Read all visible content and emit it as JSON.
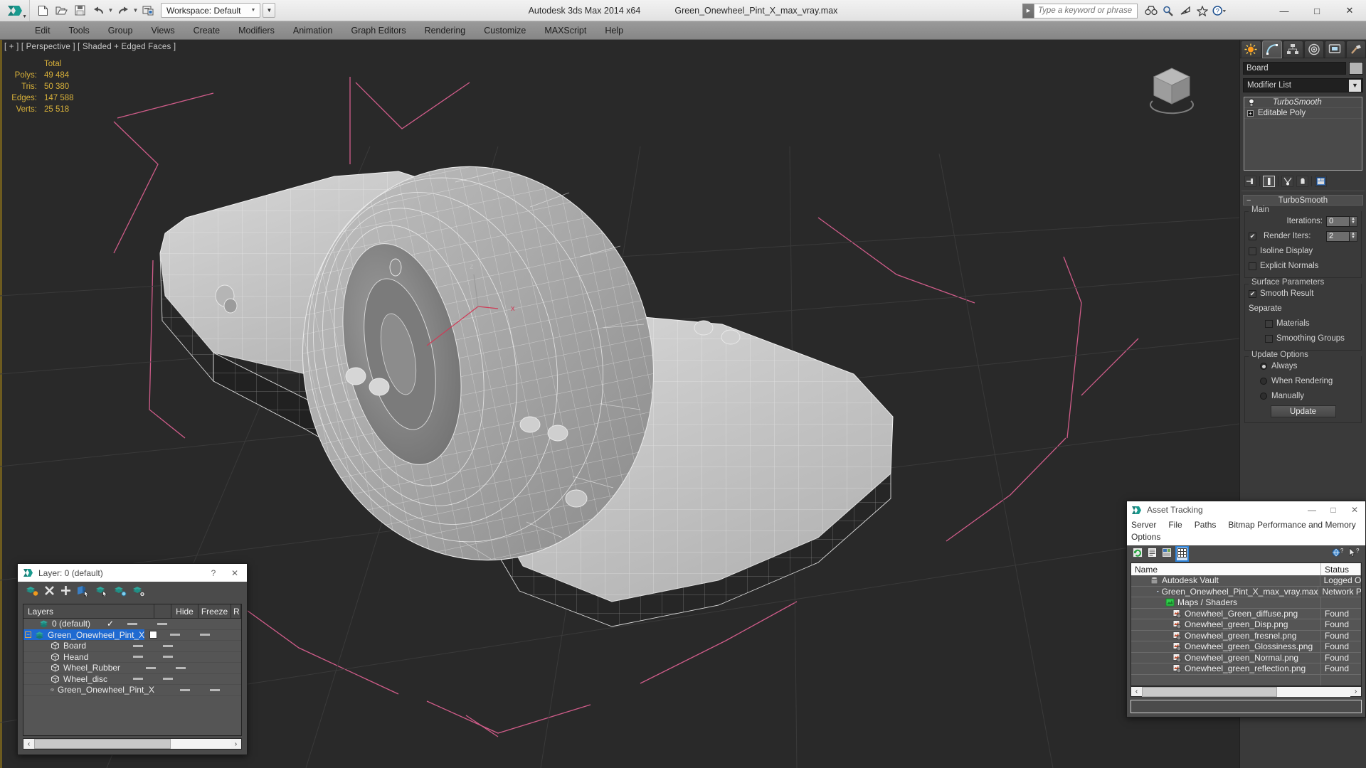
{
  "app": {
    "title": "Autodesk 3ds Max  2014 x64",
    "filename": "Green_Onewheel_Pint_X_max_vray.max",
    "workspace_label": "Workspace: Default",
    "search_placeholder": "Type a keyword or phrase"
  },
  "quick_access": [
    {
      "name": "new-file-icon",
      "tip": "New"
    },
    {
      "name": "open-file-icon",
      "tip": "Open"
    },
    {
      "name": "save-file-icon",
      "tip": "Save"
    },
    {
      "name": "undo-icon",
      "tip": "Undo"
    },
    {
      "name": "redo-icon",
      "tip": "Redo"
    },
    {
      "name": "project-folder-icon",
      "tip": "Set Project Folder"
    }
  ],
  "help_icons": [
    {
      "name": "search-binoculars-icon"
    },
    {
      "name": "magnifier-icon"
    },
    {
      "name": "satellite-icon"
    },
    {
      "name": "favorites-star-icon"
    },
    {
      "name": "help-question-icon"
    }
  ],
  "window_buttons": {
    "minimize": "—",
    "maximize": "□",
    "close": "✕"
  },
  "menu": [
    "Edit",
    "Tools",
    "Group",
    "Views",
    "Create",
    "Modifiers",
    "Animation",
    "Graph Editors",
    "Rendering",
    "Customize",
    "MAXScript",
    "Help"
  ],
  "viewport": {
    "label": "[ + ] [ Perspective ] [ Shaded + Edged Faces ]",
    "stats_header": "Total",
    "stats": [
      {
        "key": "Polys:",
        "value": "49 484"
      },
      {
        "key": "Tris:",
        "value": "50 380"
      },
      {
        "key": "Edges:",
        "value": "147 588"
      },
      {
        "key": "Verts:",
        "value": "25 518"
      }
    ],
    "stat_color": "#d8b13a",
    "background": "#292929"
  },
  "command_panel": {
    "tabs": [
      {
        "name": "create-tab",
        "label": "Create",
        "active": false
      },
      {
        "name": "modify-tab",
        "label": "Modify",
        "active": true
      },
      {
        "name": "hierarchy-tab",
        "label": "Hierarchy",
        "active": false
      },
      {
        "name": "motion-tab",
        "label": "Motion",
        "active": false
      },
      {
        "name": "display-tab",
        "label": "Display",
        "active": false
      },
      {
        "name": "utilities-tab",
        "label": "Utilities",
        "active": false
      }
    ],
    "object_name": "Board",
    "modifier_list_label": "Modifier List",
    "stack": [
      {
        "label": "TurboSmooth",
        "type": "modifier",
        "italic": true
      },
      {
        "label": "Editable Poly",
        "type": "base",
        "italic": false
      }
    ],
    "stack_tools": [
      {
        "name": "pin-stack-icon"
      },
      {
        "name": "show-end-result-icon",
        "active": true
      },
      {
        "name": "make-unique-icon"
      },
      {
        "name": "remove-modifier-icon"
      },
      {
        "name": "configure-modifier-sets-icon"
      }
    ],
    "rollout": {
      "title": "TurboSmooth",
      "groups": [
        {
          "title": "Main",
          "fields": [
            {
              "type": "spinner",
              "label": "Iterations:",
              "value": "0"
            },
            {
              "type": "spinner-check",
              "label": "Render Iters:",
              "value": "2",
              "checked": true
            },
            {
              "type": "checkbox",
              "label": "Isoline Display",
              "checked": false
            },
            {
              "type": "checkbox",
              "label": "Explicit Normals",
              "checked": false
            }
          ]
        },
        {
          "title": "Surface Parameters",
          "fields": [
            {
              "type": "checkbox",
              "label": "Smooth Result",
              "checked": true
            },
            {
              "type": "label",
              "label": "Separate"
            },
            {
              "type": "checkbox",
              "label": "Materials",
              "checked": false,
              "indent": true
            },
            {
              "type": "checkbox",
              "label": "Smoothing Groups",
              "checked": false,
              "indent": true
            }
          ]
        },
        {
          "title": "Update Options",
          "fields": [
            {
              "type": "radio",
              "label": "Always",
              "checked": true
            },
            {
              "type": "radio",
              "label": "When Rendering",
              "checked": false
            },
            {
              "type": "radio",
              "label": "Manually",
              "checked": false
            },
            {
              "type": "button",
              "label": "Update"
            }
          ]
        }
      ]
    }
  },
  "layer_dialog": {
    "title": "Layer: 0 (default)",
    "help_btn": "?",
    "close_btn": "✕",
    "toolbar": [
      {
        "name": "create-new-layer-icon"
      },
      {
        "name": "delete-layer-icon"
      },
      {
        "name": "add-selection-to-layer-icon"
      },
      {
        "name": "select-objects-in-layer-icon"
      },
      {
        "name": "select-highlighted-objects-icon"
      },
      {
        "name": "highlight-selected-objects-icon"
      },
      {
        "name": "layer-properties-icon"
      }
    ],
    "columns": [
      "Layers",
      "",
      "Hide",
      "Freeze",
      "R"
    ],
    "rows": [
      {
        "label": "0 (default)",
        "indent": 1,
        "icon": "layer-icon",
        "current": true,
        "selected": false,
        "expander": ""
      },
      {
        "label": "Green_Onewheel_Pint_X",
        "indent": 0,
        "icon": "layer-icon",
        "current": false,
        "selected": true,
        "expander": "-"
      },
      {
        "label": "Board",
        "indent": 2,
        "icon": "object-icon",
        "current": false,
        "selected": false,
        "expander": ""
      },
      {
        "label": "Heand",
        "indent": 2,
        "icon": "object-icon",
        "current": false,
        "selected": false,
        "expander": ""
      },
      {
        "label": "Wheel_Rubber",
        "indent": 2,
        "icon": "object-icon",
        "current": false,
        "selected": false,
        "expander": ""
      },
      {
        "label": "Wheel_disc",
        "indent": 2,
        "icon": "object-icon",
        "current": false,
        "selected": false,
        "expander": ""
      },
      {
        "label": "Green_Onewheel_Pint_X",
        "indent": 2,
        "icon": "object-icon",
        "current": false,
        "selected": false,
        "expander": ""
      }
    ],
    "scroll_left": "‹",
    "scroll_right": "›"
  },
  "asset_tracking": {
    "title": "Asset Tracking",
    "menu": [
      "Server",
      "File",
      "Paths",
      "Bitmap Performance and Memory",
      "Options"
    ],
    "toolbar": [
      {
        "name": "refresh-icon"
      },
      {
        "name": "list-view-icon"
      },
      {
        "name": "thumbnail-view-icon"
      },
      {
        "name": "grid-view-icon",
        "active": true
      },
      {
        "name": "network-help-icon"
      },
      {
        "name": "help-cursor-icon"
      }
    ],
    "columns": [
      "Name",
      "Status"
    ],
    "rows": [
      {
        "label": "Autodesk Vault",
        "status": "Logged O",
        "indent": 1,
        "icon": "vault-icon"
      },
      {
        "label": "Green_Onewheel_Pint_X_max_vray.max",
        "status": "Network P",
        "indent": 2,
        "icon": "max-file-icon"
      },
      {
        "label": "Maps / Shaders",
        "status": "",
        "indent": 3,
        "icon": "maps-icon"
      },
      {
        "label": "Onewheel_Green_diffuse.png",
        "status": "Found",
        "indent": 4,
        "icon": "bitmap-icon"
      },
      {
        "label": "Onewheel_green_Disp.png",
        "status": "Found",
        "indent": 4,
        "icon": "bitmap-icon"
      },
      {
        "label": "Onewheel_green_fresnel.png",
        "status": "Found",
        "indent": 4,
        "icon": "bitmap-icon"
      },
      {
        "label": "Onewheel_green_Glossiness.png",
        "status": "Found",
        "indent": 4,
        "icon": "bitmap-icon"
      },
      {
        "label": "Onewheel_green_Normal.png",
        "status": "Found",
        "indent": 4,
        "icon": "bitmap-icon"
      },
      {
        "label": "Onewheel_green_reflection.png",
        "status": "Found",
        "indent": 4,
        "icon": "bitmap-icon"
      }
    ],
    "window_buttons": {
      "minimize": "—",
      "maximize": "□",
      "close": "✕"
    },
    "scroll_left": "‹",
    "scroll_right": "›"
  },
  "colors": {
    "accent_blue": "#1f6ad1",
    "stat_yellow": "#d8b13a",
    "viewport_bg": "#292929",
    "panel_bg": "#3a3a3a",
    "grid_pink": "#d95f8f",
    "model_light": "#c9c9c9",
    "model_dark": "#2a2a2a"
  }
}
